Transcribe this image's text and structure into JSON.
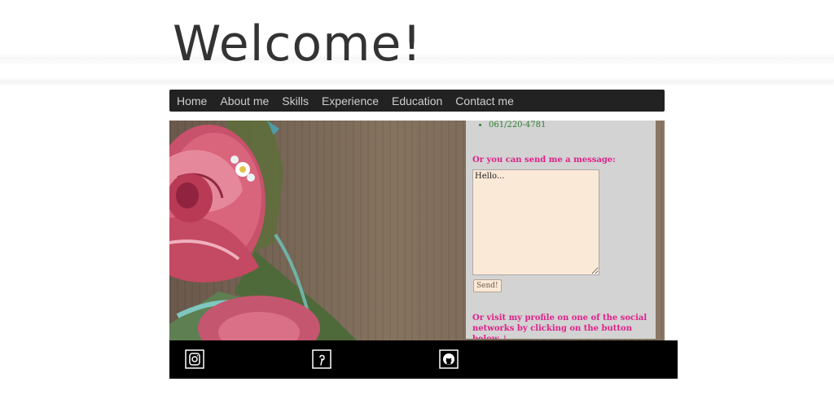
{
  "page": {
    "title": "Welcome!"
  },
  "nav": {
    "items": [
      "Home",
      "About me",
      "Skills",
      "Experience",
      "Education",
      "Contact me"
    ]
  },
  "contact": {
    "phone": "061/220-4781",
    "message_label": "Or you can send me a message:",
    "message_value": "Hello...",
    "send_label": "Send!",
    "social_text": "Or visit my profile on one of the social networks by clicking on the button below ↓"
  },
  "footer": {
    "icons": [
      "instagram-icon",
      "pinterest-icon",
      "github-icon"
    ]
  },
  "colors": {
    "nav_bg": "#222222",
    "accent_pink": "#e0218a",
    "textarea_bg": "#fbe9d7",
    "footer_bg": "#000000"
  }
}
